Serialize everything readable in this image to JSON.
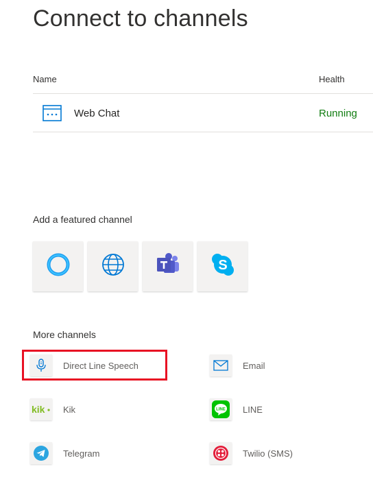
{
  "page": {
    "title": "Connect to channels"
  },
  "table": {
    "headers": {
      "name": "Name",
      "health": "Health"
    },
    "rows": [
      {
        "name": "Web Chat",
        "health": "Running",
        "icon": "web-chat-icon"
      }
    ]
  },
  "featured": {
    "label": "Add a featured channel",
    "channels": [
      {
        "icon": "cortana-icon"
      },
      {
        "icon": "globe-icon"
      },
      {
        "icon": "teams-icon"
      },
      {
        "icon": "skype-icon"
      }
    ]
  },
  "more": {
    "label": "More channels",
    "channels": [
      {
        "label": "Direct Line Speech",
        "icon": "microphone-icon",
        "highlighted": true
      },
      {
        "label": "Email",
        "icon": "email-icon"
      },
      {
        "label": "Kik",
        "icon": "kik-icon"
      },
      {
        "label": "LINE",
        "icon": "line-icon"
      },
      {
        "label": "Telegram",
        "icon": "telegram-icon"
      },
      {
        "label": "Twilio (SMS)",
        "icon": "twilio-icon"
      }
    ]
  },
  "colors": {
    "running": "#107c10",
    "accent": "#0078d4",
    "highlight": "#e81123"
  }
}
